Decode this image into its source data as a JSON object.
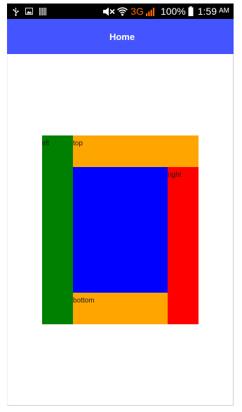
{
  "status_bar": {
    "network": "3G",
    "battery": "100%",
    "time": "1:59",
    "ampm": "AM",
    "icons": [
      "usb-icon",
      "image-icon",
      "barcode-icon",
      "mute-icon",
      "wifi-icon",
      "signal-icon",
      "battery-icon"
    ]
  },
  "header": {
    "title": "Home",
    "color": "#4455ff"
  },
  "layout_panels": {
    "left": {
      "label": "left",
      "color": "#008000"
    },
    "top": {
      "label": "top",
      "color": "#ffa500"
    },
    "right": {
      "label": "right",
      "color": "#ff0000"
    },
    "bottom": {
      "label": "bottom",
      "color": "#ffa500"
    },
    "center": {
      "color": "#0000ff"
    }
  }
}
